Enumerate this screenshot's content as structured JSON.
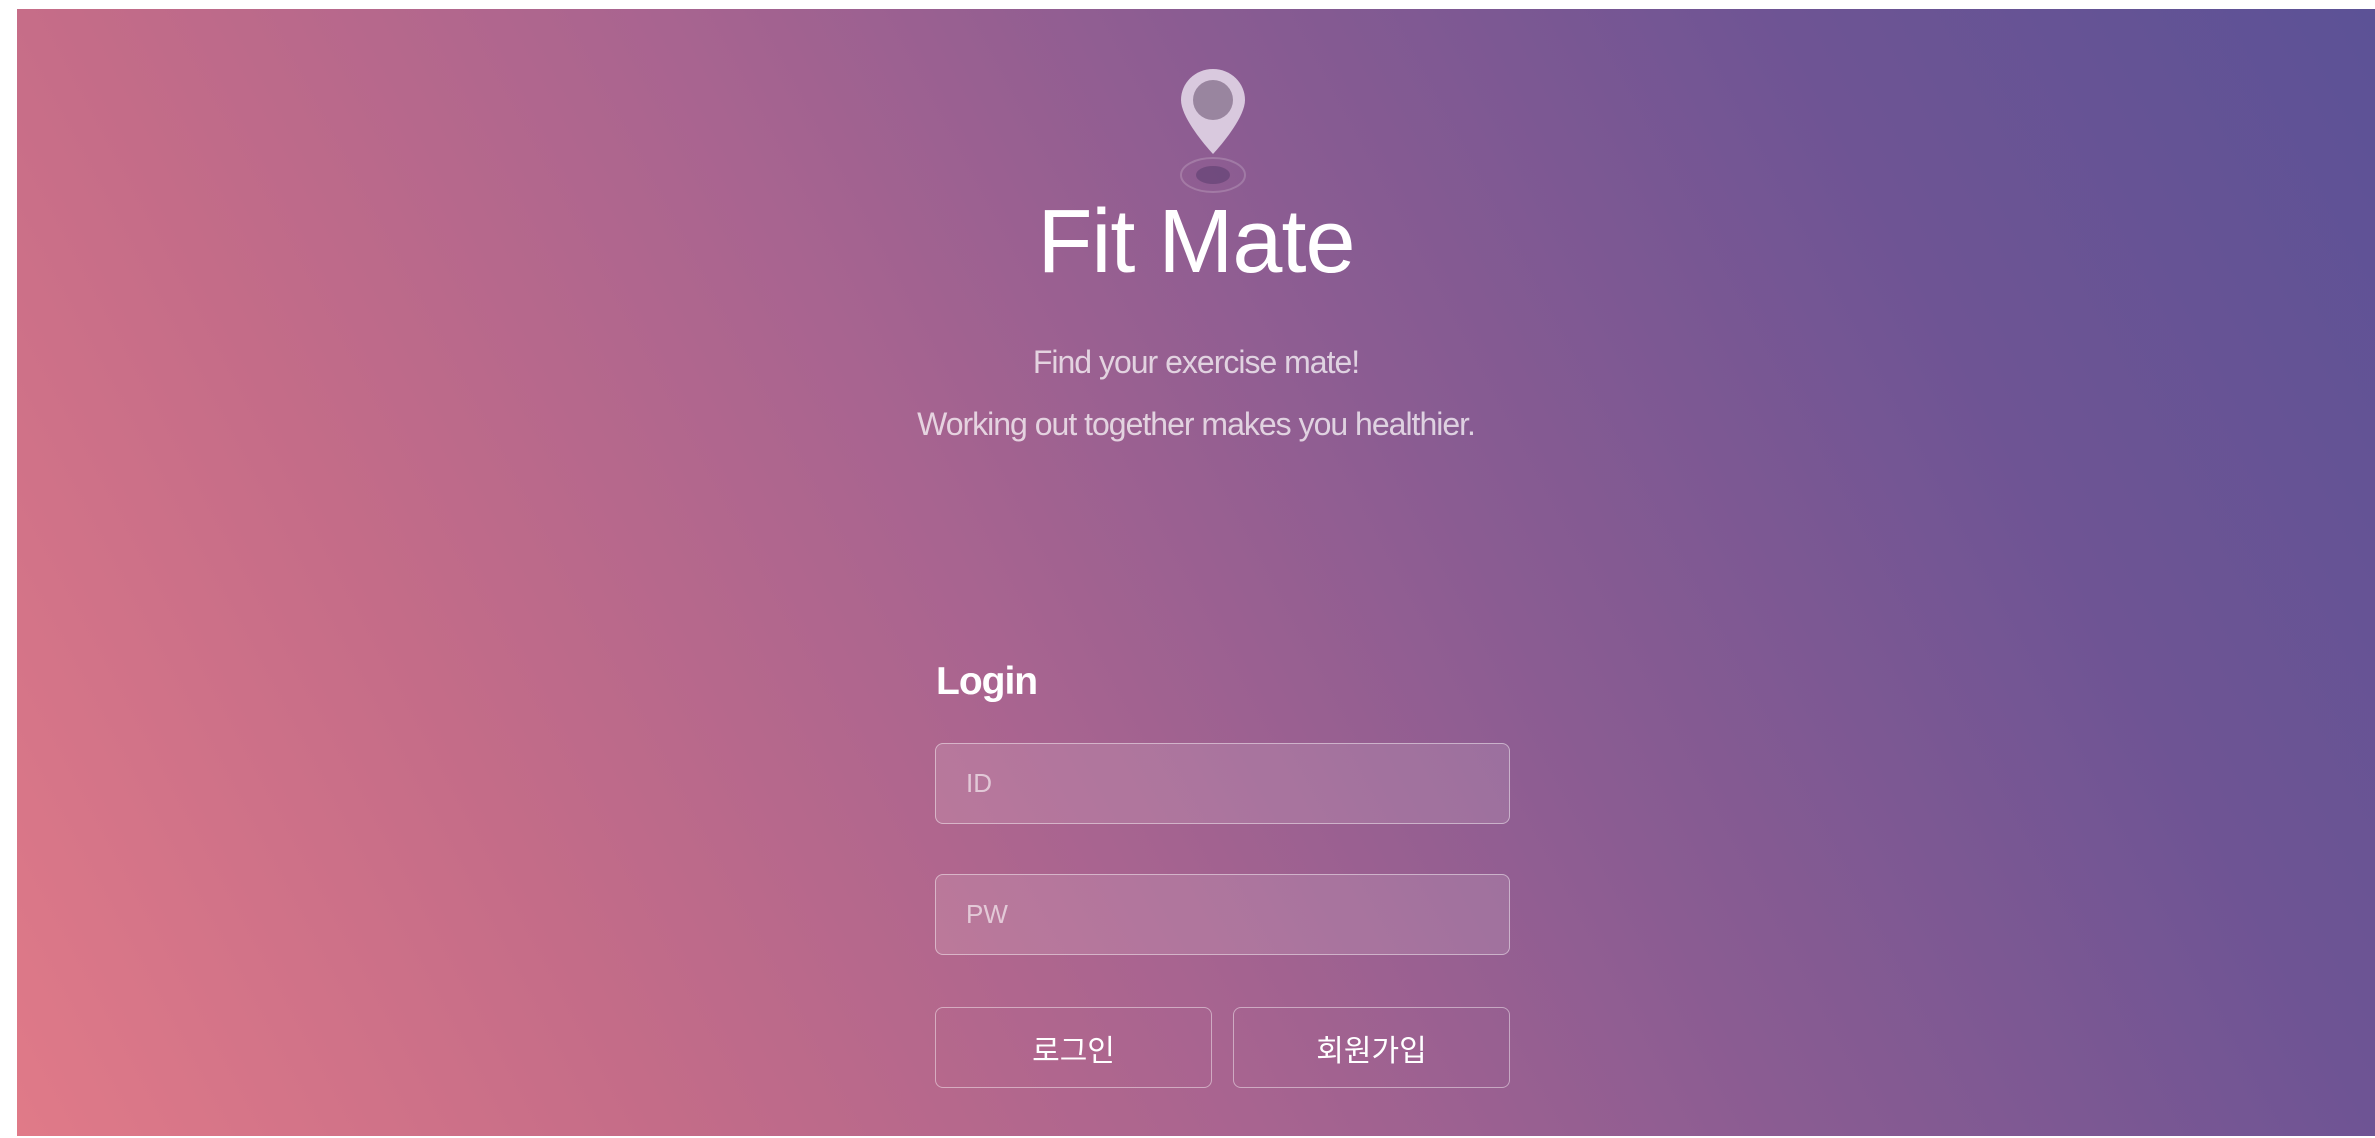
{
  "app": {
    "title": "Fit Mate",
    "tagline_1": "Find your exercise mate!",
    "tagline_2": "Working out together makes you healthier.",
    "logo_icon": "location-pin-icon"
  },
  "login": {
    "heading": "Login",
    "id_placeholder": "ID",
    "pw_placeholder": "PW",
    "login_button": "로그인",
    "signup_button": "회원가입"
  },
  "colors": {
    "gradient_start": "#e07a88",
    "gradient_end": "#5c5296",
    "text": "#ffffff"
  }
}
